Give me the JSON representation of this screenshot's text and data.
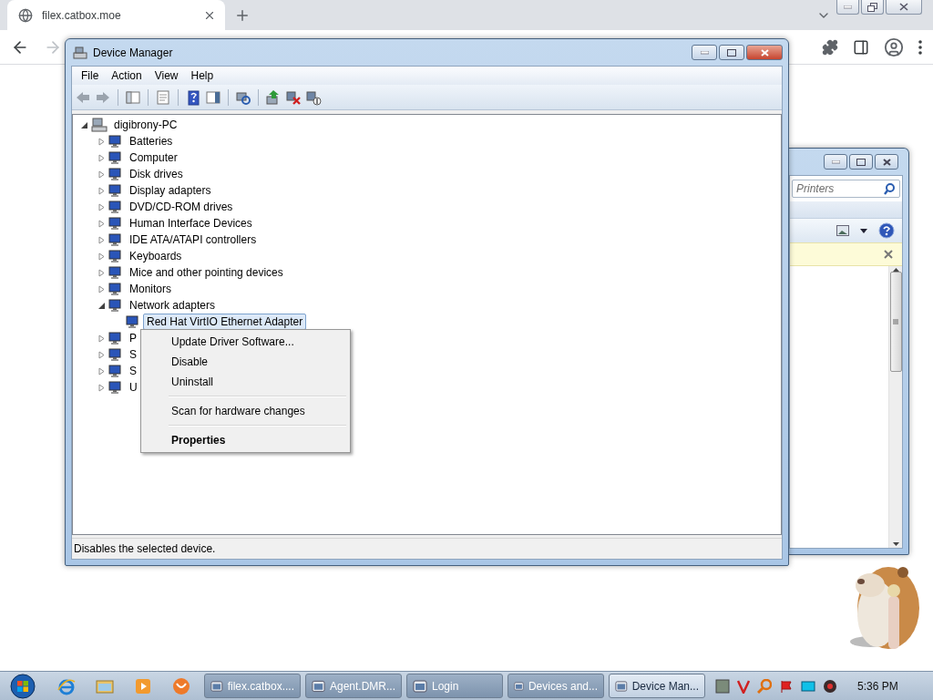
{
  "browser": {
    "tab": {
      "title": "filex.catbox.moe"
    }
  },
  "device_manager": {
    "title": "Device Manager",
    "menu": [
      "File",
      "Action",
      "View",
      "Help"
    ],
    "tree": {
      "label": "digibrony-PC",
      "expanded": true,
      "children": [
        {
          "label": "Batteries",
          "expanded": false
        },
        {
          "label": "Computer",
          "expanded": false
        },
        {
          "label": "Disk drives",
          "expanded": false
        },
        {
          "label": "Display adapters",
          "expanded": false
        },
        {
          "label": "DVD/CD-ROM drives",
          "expanded": false
        },
        {
          "label": "Human Interface Devices",
          "expanded": false
        },
        {
          "label": "IDE ATA/ATAPI controllers",
          "expanded": false
        },
        {
          "label": "Keyboards",
          "expanded": false
        },
        {
          "label": "Mice and other pointing devices",
          "expanded": false
        },
        {
          "label": "Monitors",
          "expanded": false
        },
        {
          "label": "Network adapters",
          "expanded": true,
          "children": [
            {
              "label": "Red Hat VirtIO Ethernet Adapter",
              "selected": true
            }
          ]
        },
        {
          "label": "P",
          "expanded": false
        },
        {
          "label": "S",
          "expanded": false
        },
        {
          "label": "S",
          "expanded": false
        },
        {
          "label": "U",
          "expanded": false
        }
      ]
    },
    "status": "Disables the selected device."
  },
  "context_menu": {
    "items": [
      {
        "kind": "item",
        "label": "Update Driver Software...",
        "default": false
      },
      {
        "kind": "item",
        "label": "Disable",
        "default": false
      },
      {
        "kind": "item",
        "label": "Uninstall",
        "default": false
      },
      {
        "kind": "separator"
      },
      {
        "kind": "item",
        "label": "Scan for hardware changes",
        "default": false
      },
      {
        "kind": "separator"
      },
      {
        "kind": "item",
        "label": "Properties",
        "default": true
      }
    ]
  },
  "background_window": {
    "search": {
      "placeholder": "Printers"
    }
  },
  "taskbar": {
    "tasks": [
      {
        "label": "filex.catbox....",
        "selected": false
      },
      {
        "label": "Agent.DMR...",
        "selected": false
      },
      {
        "label": "Login",
        "selected": false
      },
      {
        "label": "Devices and...",
        "selected": false
      },
      {
        "label": "Device Man...",
        "selected": true
      }
    ],
    "clock": "5:36 PM"
  }
}
